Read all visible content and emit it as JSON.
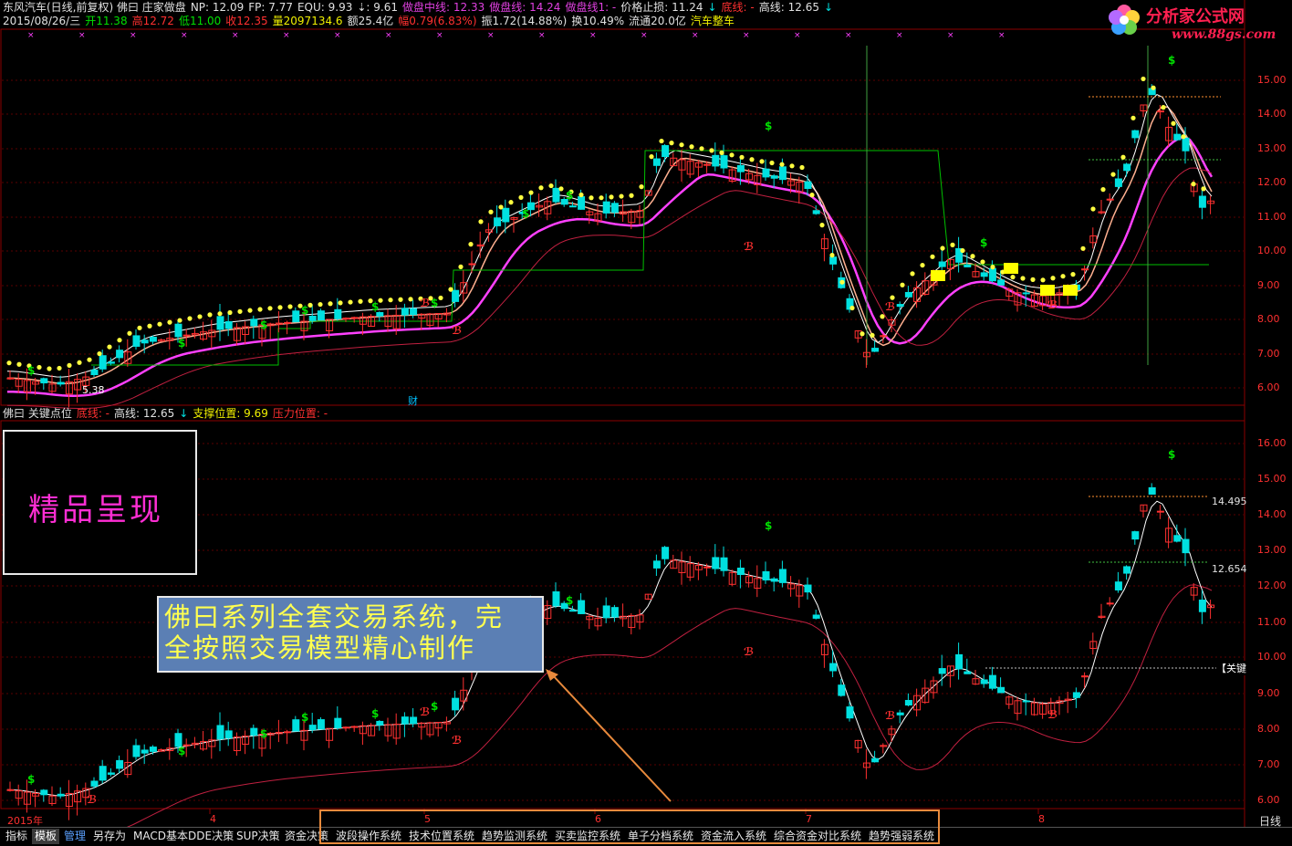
{
  "header": {
    "line1": [
      {
        "text": "东风汽车(日线,前复权) 佛曰 庄家做盘",
        "color": "w"
      },
      {
        "text": "NP: 12.09",
        "color": "w"
      },
      {
        "text": "FP: 7.77",
        "color": "w"
      },
      {
        "text": "EQU: 9.93",
        "color": "w"
      },
      {
        "text": "⇣: 9.61",
        "color": "w"
      },
      {
        "text": "做盘中线: 12.33",
        "color": "m"
      },
      {
        "text": "做盘线: 14.24",
        "color": "m"
      },
      {
        "text": "做盘线1: -",
        "color": "m"
      },
      {
        "text": "价格止损: 11.24",
        "color": "w"
      },
      {
        "text": "↓",
        "color": "c"
      },
      {
        "text": "底线: -",
        "color": "r"
      },
      {
        "text": "高线: 12.65",
        "color": "w"
      },
      {
        "text": "↓",
        "color": "c"
      }
    ],
    "line2": [
      {
        "text": "2015/08/26/三",
        "color": "w"
      },
      {
        "text": "开11.38",
        "color": "g"
      },
      {
        "text": "高12.72",
        "color": "r"
      },
      {
        "text": "低11.00",
        "color": "g"
      },
      {
        "text": "收12.35",
        "color": "r"
      },
      {
        "text": "量2097134.6",
        "color": "y"
      },
      {
        "text": "额25.4亿",
        "color": "w"
      },
      {
        "text": "幅0.79(6.83%)",
        "color": "r"
      },
      {
        "text": "振1.72(14.88%)",
        "color": "w"
      },
      {
        "text": "换10.49%",
        "color": "w"
      },
      {
        "text": "流通20.0亿",
        "color": "w"
      },
      {
        "text": "汽车整车",
        "color": "y"
      }
    ],
    "line3": [
      {
        "text": "佛曰 关键点位",
        "color": "w"
      },
      {
        "text": "底线: -",
        "color": "r"
      },
      {
        "text": "高线: 12.65",
        "color": "w"
      },
      {
        "text": "↓",
        "color": "c"
      },
      {
        "text": "支撑位置: 9.69",
        "color": "y"
      },
      {
        "text": "压力位置: -",
        "color": "r"
      }
    ]
  },
  "logo": {
    "name": "分析家公式网",
    "url": "www.88gs.com"
  },
  "promo_text": "精品呈现",
  "callout": {
    "line1": "佛曰系列全套交易系统，完",
    "line2": "全按照交易模型精心制作"
  },
  "price_axis_top": [
    "15.00",
    "14.00",
    "13.00",
    "12.00",
    "11.00",
    "10.00",
    "9.00",
    "8.00",
    "7.00",
    "6.00"
  ],
  "price_axis_bottom": [
    "16.00",
    "15.00",
    "14.00",
    "13.00",
    "12.00",
    "11.00",
    "10.00",
    "9.00",
    "8.00",
    "7.00",
    "6.00"
  ],
  "level_labels": {
    "upper": "14.495",
    "lower": "12.654",
    "key": "【关键"
  },
  "low_label": "5.38",
  "event_labels": [
    "财"
  ],
  "date_axis": [
    "2015年",
    "4",
    "5",
    "6",
    "7",
    "8"
  ],
  "period_label": "日线",
  "tabs": [
    {
      "label": "指标",
      "style": ""
    },
    {
      "label": "模板",
      "style": "sel"
    },
    {
      "label": "管理",
      "style": "blue"
    },
    {
      "label": "另存为",
      "style": ""
    },
    {
      "label": "MACD基本",
      "style": ""
    },
    {
      "label": "DDE决策",
      "style": ""
    },
    {
      "label": "SUP决策",
      "style": ""
    },
    {
      "label": "资金决策",
      "style": ""
    },
    {
      "label": "波段操作系统",
      "style": ""
    },
    {
      "label": "技术位置系统",
      "style": ""
    },
    {
      "label": "趋势监测系统",
      "style": ""
    },
    {
      "label": "买卖监控系统",
      "style": ""
    },
    {
      "label": "单子分档系统",
      "style": ""
    },
    {
      "label": "资金流入系统",
      "style": ""
    },
    {
      "label": "综合资金对比系统",
      "style": ""
    },
    {
      "label": "趋势强弱系统",
      "style": ""
    }
  ],
  "colors": {
    "up": "#ff3030",
    "down": "#00e0e0",
    "grid": "#8b0000",
    "ma": "#e040e0",
    "signal": "#00e000"
  }
}
